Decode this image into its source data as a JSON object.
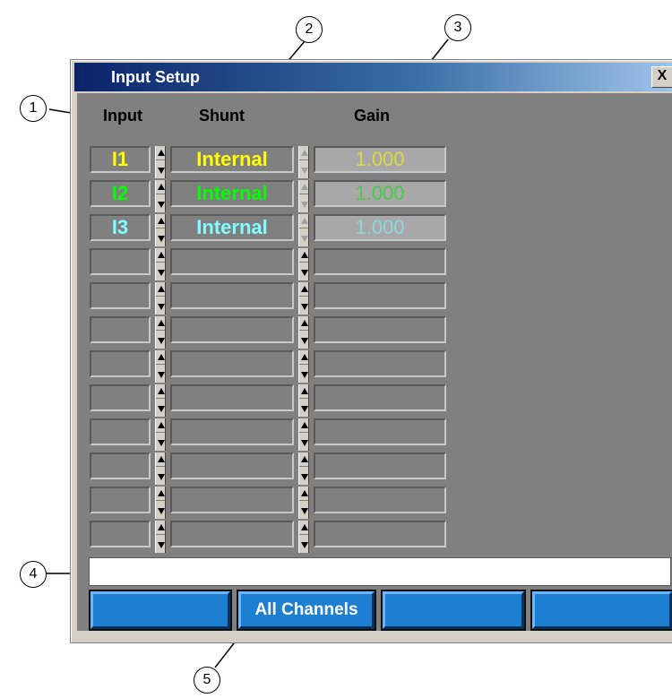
{
  "window": {
    "title": "Input Setup",
    "close_label": "X"
  },
  "headers": {
    "input": "Input",
    "shunt": "Shunt",
    "gain": "Gain"
  },
  "channels": [
    {
      "input": "I1",
      "shunt": "Internal",
      "gain": "1.000",
      "color": "#ffff00"
    },
    {
      "input": "I2",
      "shunt": "Internal",
      "gain": "1.000",
      "color": "#00ff00"
    },
    {
      "input": "I3",
      "shunt": "Internal",
      "gain": "1.000",
      "color": "#80ffff"
    }
  ],
  "gain_colors": [
    "#d8d84a",
    "#4ac84a",
    "#8ed6dc"
  ],
  "empty_rows": 9,
  "status_field": {
    "value": ""
  },
  "buttons": [
    "",
    "All Channels",
    "",
    ""
  ],
  "callouts": [
    "1",
    "2",
    "3",
    "4",
    "5"
  ],
  "colors": {
    "client_bg": "#808080",
    "button_blue": "#1c7fd2",
    "title_start": "#0a246a",
    "title_end": "#a6caf0"
  }
}
